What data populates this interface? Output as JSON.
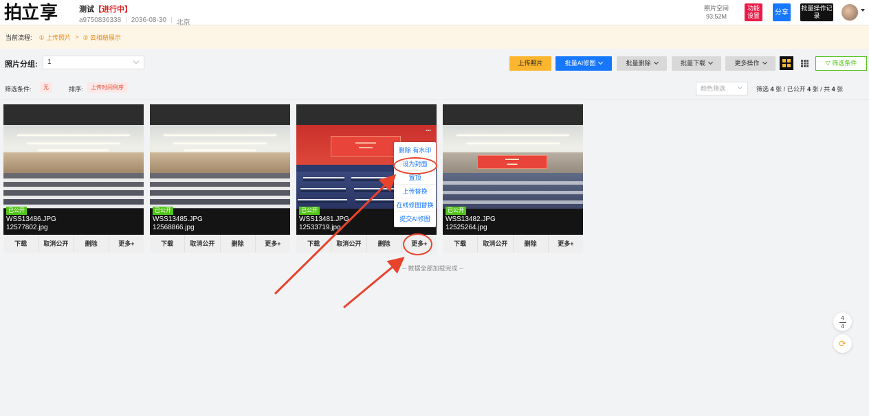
{
  "logo": {
    "part1": "拍立",
    "part2": "享"
  },
  "project": {
    "title": "测试",
    "status": "【进行中】",
    "id": "a9750836338",
    "date": "2036-08-30",
    "location": "北京"
  },
  "header": {
    "space_label": "照片空间",
    "space_value": "93.52M",
    "func_label": "功能设置",
    "share_label": "分享",
    "batch_log_label": "批量操作记录"
  },
  "flow": {
    "label": "当前流程:",
    "step1": "① 上传照片",
    "arrow": ">",
    "step2": "② 云相册展示"
  },
  "toolbar": {
    "group_label": "照片分组:",
    "group_value": "1",
    "upload": "上传照片",
    "batch_ai": "批量AI修图",
    "batch_delete": "批量删除",
    "batch_download": "批量下载",
    "more_ops": "更多操作",
    "filter_btn": "▽ 筛选条件"
  },
  "filters": {
    "label": "筛选条件:",
    "value": "无",
    "sort_label": "排序:",
    "sort_value": "上传时间倒序",
    "color_placeholder": "颜色筛选",
    "stats": {
      "p1": "筛选",
      "filtered": "4",
      "p2": "张 / 已公开",
      "public": "4",
      "p3": "张 / 共",
      "total": "4",
      "p4": "张"
    }
  },
  "photos": [
    {
      "badge": "已公开",
      "name": "WSS13486.JPG",
      "file": "12577802.jpg"
    },
    {
      "badge": "已公开",
      "name": "WSS13485.JPG",
      "file": "12568866.jpg"
    },
    {
      "badge": "已公开",
      "name": "WSS13481.JPG",
      "file": "12533719.jpg"
    },
    {
      "badge": "已公开",
      "name": "WSS13482.JPG",
      "file": "12525264.jpg"
    }
  ],
  "actions": {
    "download": "下载",
    "unpublish": "取消公开",
    "delete": "删除",
    "more": "更多+"
  },
  "menu": {
    "items": [
      "删除 有水印",
      "设为封面",
      "置顶",
      "上传替换",
      "在线修图替换",
      "提交AI修图"
    ]
  },
  "loaded_text": "-- 数据全部加载完成 --",
  "pager": {
    "current": "4",
    "total": "4"
  },
  "colors": {
    "accent": "#1677ff",
    "upload": "#fbb52e",
    "public": "#52c41a",
    "annotation": "#e8432d"
  }
}
